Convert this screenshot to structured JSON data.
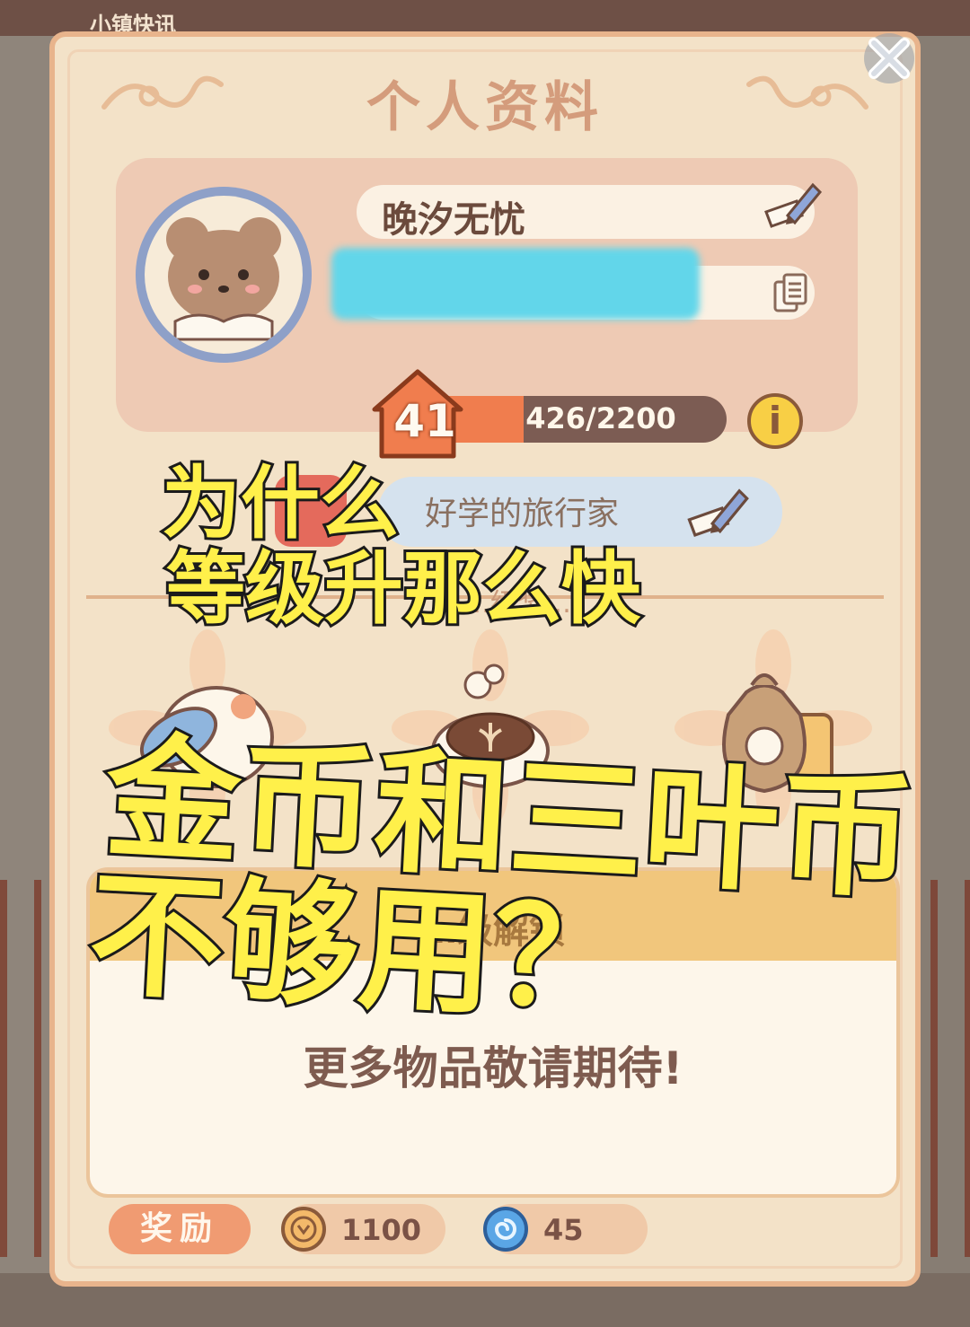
{
  "background": {
    "top_label": "小镇快讯"
  },
  "panel": {
    "title": "个人资料"
  },
  "profile": {
    "name": "晚汐无忧",
    "level": "41",
    "exp_text": "426/2200",
    "exp_progress": 0.194,
    "info_label": "i"
  },
  "title_row": {
    "title": "好学的旅行家",
    "divider_label": "…级奖…"
  },
  "unlock": {
    "header": "…级解锁",
    "message": "更多物品敬请期待!"
  },
  "rewards": {
    "label": "奖励",
    "coins": "1100",
    "clover": "45"
  },
  "captions": {
    "line1": "为什么",
    "line2": "等级升那么快",
    "line3": "金币和三叶币",
    "line4": "不够用？"
  },
  "colors": {
    "panel_bg": "#f3e2c8",
    "accent": "#f07d4e",
    "caption_fill": "#fff04a"
  }
}
